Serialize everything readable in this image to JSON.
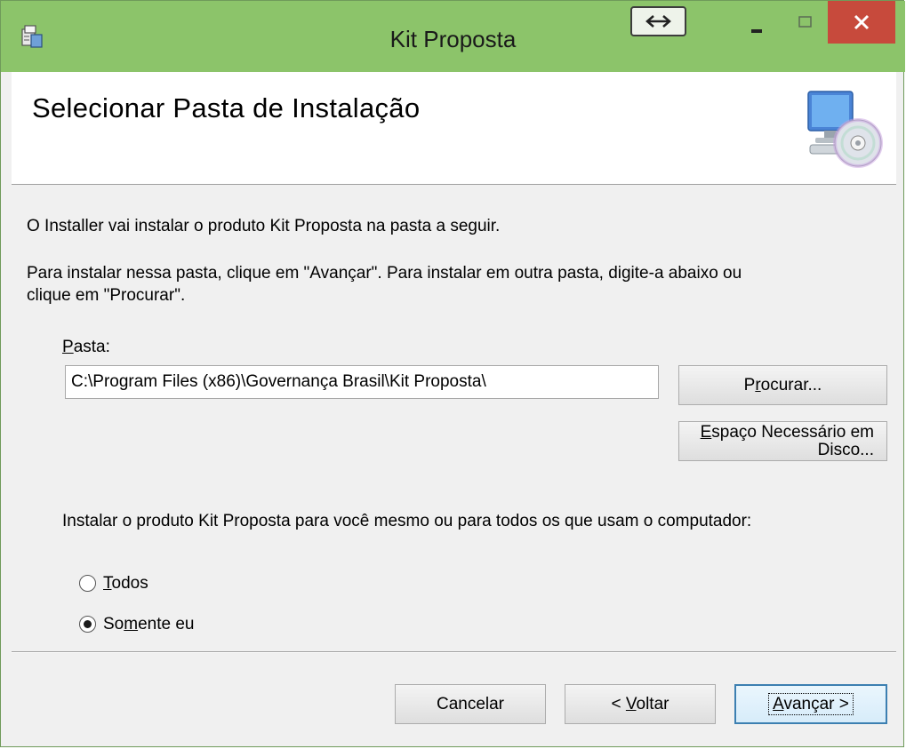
{
  "window": {
    "title": "Kit Proposta",
    "controls": {
      "snap": "⇔",
      "minimize": "–",
      "maximize": "□",
      "close": "✕"
    },
    "colors": {
      "titlebar": "#8cc46a",
      "close": "#c74a3c"
    }
  },
  "header": {
    "title": "Selecionar Pasta de Instalação"
  },
  "content": {
    "intro": "O Installer vai instalar o produto Kit Proposta na pasta a seguir.",
    "instructions_line1": "Para instalar nessa pasta, clique em \"Avançar\". Para instalar em outra pasta, digite-a abaixo ou",
    "instructions_line2": "clique em \"Procurar\".",
    "folder_label_mnemonic": "P",
    "folder_label_rest": "asta:",
    "folder_path": "C:\\Program Files (x86)\\Governança Brasil\\Kit Proposta\\",
    "browse_button": {
      "pre": "P",
      "mnemonic": "r",
      "post": "ocurar..."
    },
    "disk_cost_button": {
      "mnemonic": "E",
      "line1_rest": "spaço Necessário em",
      "line2": "Disco..."
    },
    "install_for_label": "Instalar o produto Kit Proposta para você mesmo ou para todos os que usam o computador:",
    "radio_everyone": {
      "mnemonic": "T",
      "rest": "odos",
      "checked": false
    },
    "radio_just_me": {
      "pre": "So",
      "mnemonic": "m",
      "post": "ente eu",
      "checked": true
    }
  },
  "footer": {
    "cancel": "Cancelar",
    "back": {
      "pre": "< ",
      "mnemonic": "V",
      "post": "oltar"
    },
    "next": {
      "mnemonic": "A",
      "post": "vançar >"
    }
  }
}
